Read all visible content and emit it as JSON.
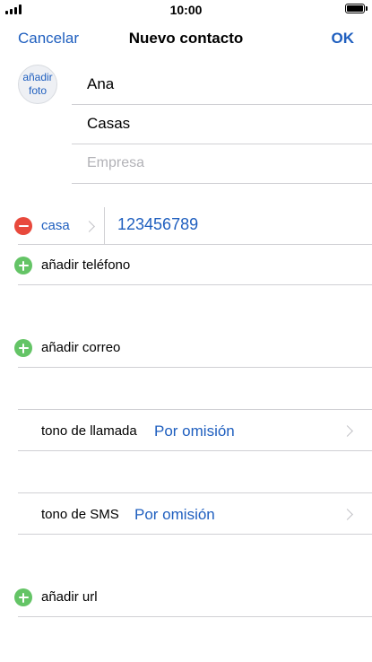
{
  "status": {
    "time": "10:00"
  },
  "nav": {
    "cancel": "Cancelar",
    "title": "Nuevo contacto",
    "ok": "OK"
  },
  "avatar": {
    "line1": "añadir",
    "line2": "foto"
  },
  "fields": {
    "first_name": "Ana",
    "last_name": "Casas",
    "company_placeholder": "Empresa"
  },
  "phone": {
    "label": "casa",
    "value": "123456789"
  },
  "actions": {
    "add_phone": "añadir teléfono",
    "add_email": "añadir correo",
    "add_url": "añadir url"
  },
  "ringtone": {
    "label": "tono de llamada",
    "value": "Por omisión"
  },
  "sms_tone": {
    "label": "tono de SMS",
    "value": "Por omisión"
  },
  "colors": {
    "accent": "#1f5fbf",
    "delete": "#e8493c",
    "add": "#64c466"
  },
  "icons": [
    "signal-icon",
    "battery-icon",
    "remove-circle-icon",
    "add-circle-icon",
    "chevron-right-icon"
  ]
}
